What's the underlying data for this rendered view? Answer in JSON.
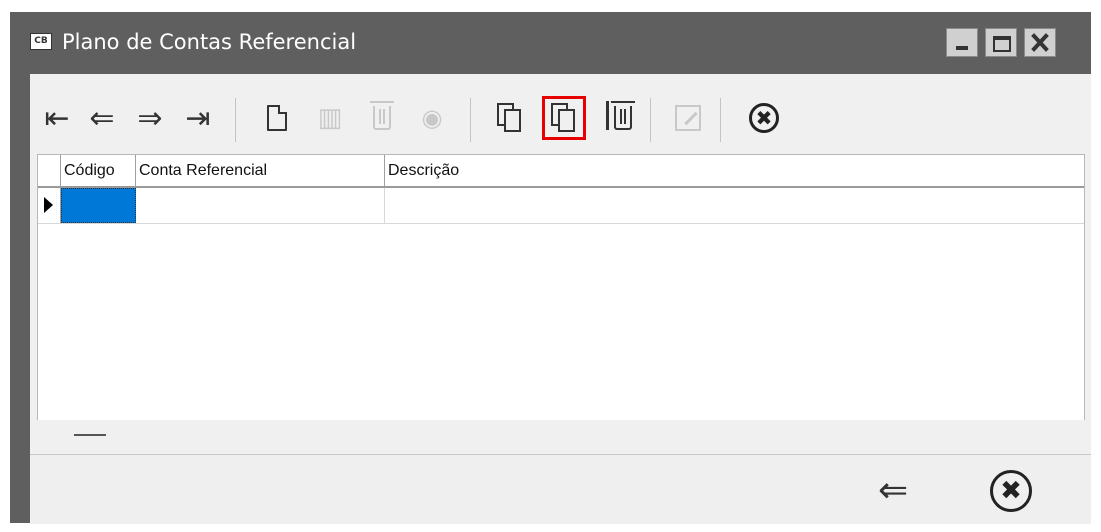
{
  "window": {
    "title": "Plano de Contas Referencial",
    "app_icon_text": "CB"
  },
  "toolbar": {
    "first": "first-record-icon",
    "prev": "previous-record-icon",
    "next": "next-record-icon",
    "last": "last-record-icon",
    "new": "new-document-icon",
    "save": "save-icon",
    "delete": "delete-icon",
    "view": "view-icon",
    "copy": "copy-icon",
    "copy_highlighted": "copy-icon",
    "delete_all": "delete-all-icon",
    "edit": "edit-icon",
    "close": "close-circle-icon",
    "glyphs": {
      "first": "⇤",
      "prev": "⇐",
      "next": "⇒",
      "last": "⇥",
      "view": "◉",
      "save": "▥",
      "close_x": "✖"
    }
  },
  "grid": {
    "columns": [
      "Código",
      "Conta Referencial",
      "Descrição"
    ],
    "rows": [
      {
        "codigo": "",
        "conta": "",
        "descricao": ""
      }
    ]
  },
  "bottombar": {
    "back_glyph": "⇐",
    "close_glyph": "✖"
  },
  "colors": {
    "titlebar": "#5f5f5f",
    "selection": "#0078d7",
    "highlight": "#e60000"
  }
}
